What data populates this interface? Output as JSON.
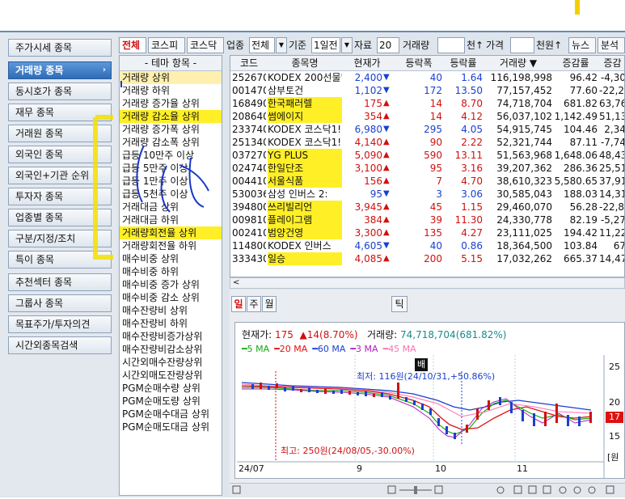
{
  "nav": {
    "items": [
      {
        "label": "주가시세 종목",
        "active": false
      },
      {
        "label": "거래량 종목",
        "active": true
      },
      {
        "label": "동시호가 종목",
        "active": false
      },
      {
        "label": "재무 종목",
        "active": false
      },
      {
        "label": "거래원 종목",
        "active": false
      },
      {
        "label": "외국인 종목",
        "active": false
      },
      {
        "label": "외국인+기관 순위",
        "active": false
      },
      {
        "label": "투자자 종목",
        "active": false
      },
      {
        "label": "업종별 종목",
        "active": false
      },
      {
        "label": "구분/지정/조치",
        "active": false
      },
      {
        "label": "특이 종목",
        "active": false
      },
      {
        "label": "추천섹터 종목",
        "active": false
      },
      {
        "label": "그룹사 종목",
        "active": false
      },
      {
        "label": "목표주가/투자의견",
        "active": false
      },
      {
        "label": "시간외종목검색",
        "active": false
      }
    ],
    "active_arrow": "›"
  },
  "toolbar": {
    "market_tabs": [
      "전체",
      "코스피",
      "코스닥"
    ],
    "selected_tab": "전체",
    "sector_label": "업종",
    "sector_value": "전체",
    "basis_label": "기준",
    "basis_value": "1일전",
    "data_label": "자료",
    "data_value": "20",
    "volume_label": "거래량",
    "volume_unit": "천↑",
    "price_label": "가격",
    "price_unit": "천원↑",
    "news_label": "뉴스",
    "analysis_label": "분석",
    "dropdown_arrow": "▼"
  },
  "theme": {
    "header": "- 테마 항목 -",
    "items": [
      "거래량 상위",
      "거래량 하위",
      "거래량 증가율 상위",
      "거래량 감소율 상위",
      "거래량 증가폭 상위",
      "거래량 감소폭 상위",
      "급등 10만주 이상",
      "급등 5만주 이상",
      "급등 1만주 이상",
      "급등 5천주 이상",
      "거래대금 상위",
      "거래대금 하위",
      "거래량회전율 상위",
      "거래량회전율 하위",
      "매수비중 상위",
      "매수비중 하위",
      "매수비중 증가 상위",
      "매수비중 감소 상위",
      "매수잔량비 상위",
      "매수잔량비 하위",
      "매수잔량비증가상위",
      "매수잔량비감소상위",
      "시간외매수잔량상위",
      "시간외매도잔량상위",
      "PGM순매수량 상위",
      "PGM순매도량 상위",
      "PGM순매수대금 상위",
      "PGM순매도대금 상위"
    ],
    "selected_index": 0,
    "highlighted": [
      3,
      12
    ]
  },
  "grid": {
    "columns": [
      "코드",
      "종목명",
      "현재가",
      "등락폭",
      "등락률",
      "거래량 ▼",
      "증감률",
      "증감"
    ],
    "rows": [
      {
        "code": "252670",
        "name": "KODEX 200선물'",
        "price": "2,400",
        "dir": "down",
        "change": "40",
        "rate": "1.64",
        "volume": "116,198,998",
        "vrate": "96.42",
        "vchg": "-4,30",
        "hl": false
      },
      {
        "code": "001470",
        "name": "삼부토건",
        "price": "1,102",
        "dir": "down",
        "change": "172",
        "rate": "13.50",
        "volume": "77,157,452",
        "vrate": "77.60",
        "vchg": "-22,27",
        "hl": false
      },
      {
        "code": "168490",
        "name": "한국패러렐",
        "price": "175",
        "dir": "up",
        "change": "14",
        "rate": "8.70",
        "volume": "74,718,704",
        "vrate": "681.82",
        "vchg": "63,76",
        "hl": true
      },
      {
        "code": "208640",
        "name": "썸에이지",
        "price": "354",
        "dir": "up",
        "change": "14",
        "rate": "4.12",
        "volume": "56,037,102",
        "vrate": "1,142.49",
        "vchg": "51,13",
        "hl": true
      },
      {
        "code": "233740",
        "name": "KODEX 코스닥1!",
        "price": "6,980",
        "dir": "down",
        "change": "295",
        "rate": "4.05",
        "volume": "54,915,745",
        "vrate": "104.46",
        "vchg": "2,34",
        "hl": false
      },
      {
        "code": "251340",
        "name": "KODEX 코스닥1!",
        "price": "4,140",
        "dir": "up",
        "change": "90",
        "rate": "2.22",
        "volume": "52,321,744",
        "vrate": "87.11",
        "vchg": "-7,74",
        "hl": false
      },
      {
        "code": "037270",
        "name": "YG PLUS",
        "price": "5,090",
        "dir": "up",
        "change": "590",
        "rate": "13.11",
        "volume": "51,563,968",
        "vrate": "1,648.06",
        "vchg": "48,43",
        "hl": true
      },
      {
        "code": "024740",
        "name": "한일단조",
        "price": "3,100",
        "dir": "up",
        "change": "95",
        "rate": "3.16",
        "volume": "39,207,362",
        "vrate": "286.36",
        "vchg": "25,51",
        "hl": true
      },
      {
        "code": "004410",
        "name": "서울식품",
        "price": "156",
        "dir": "up",
        "change": "7",
        "rate": "4.70",
        "volume": "38,610,323",
        "vrate": "5,580.65",
        "vchg": "37,91",
        "hl": true
      },
      {
        "code": "530036",
        "name": "삼성 인버스 2:",
        "price": "95",
        "dir": "down",
        "change": "3",
        "rate": "3.06",
        "volume": "30,585,043",
        "vrate": "188.03",
        "vchg": "14,31",
        "hl": false
      },
      {
        "code": "394800",
        "name": "쓰리빌리언",
        "price": "3,945",
        "dir": "up",
        "change": "45",
        "rate": "1.15",
        "volume": "29,460,070",
        "vrate": "56.28",
        "vchg": "-22,88",
        "hl": true
      },
      {
        "code": "009810",
        "name": "플레이그램",
        "price": "384",
        "dir": "up",
        "change": "39",
        "rate": "11.30",
        "volume": "24,330,778",
        "vrate": "82.19",
        "vchg": "-5,27",
        "hl": true
      },
      {
        "code": "002410",
        "name": "범양건영",
        "price": "3,300",
        "dir": "up",
        "change": "135",
        "rate": "4.27",
        "volume": "23,111,025",
        "vrate": "194.42",
        "vchg": "11,22",
        "hl": true
      },
      {
        "code": "114800",
        "name": "KODEX 인버스",
        "price": "4,605",
        "dir": "down",
        "change": "40",
        "rate": "0.86",
        "volume": "18,364,500",
        "vrate": "103.84",
        "vchg": "67",
        "hl": false
      },
      {
        "code": "333430",
        "name": "일승",
        "price": "4,085",
        "dir": "up",
        "change": "200",
        "rate": "5.15",
        "volume": "17,032,262",
        "vrate": "665.37",
        "vchg": "14,47",
        "hl": true
      }
    ],
    "scroll_left": "<"
  },
  "chart_panel": {
    "periods": [
      "일",
      "주",
      "월"
    ],
    "selected_period": "일",
    "tick_label": "틱",
    "info": {
      "price_label": "현재가:",
      "price": "175",
      "change": "▲14(8.70%)",
      "volume_label": "거래량:",
      "volume": "74,718,704(681.82%)"
    },
    "ma_legend": [
      {
        "label": "5 MA",
        "color": "#14a914"
      },
      {
        "label": "20 MA",
        "color": "#e01010"
      },
      {
        "label": "60 MA",
        "color": "#1a3fd0"
      },
      {
        "label": "3 MA",
        "color": "#b020c0"
      },
      {
        "label": "45 MA",
        "color": "#ff70b0"
      }
    ],
    "annotations": {
      "max_text": "최저: 116원(24/10/31,+50.86%)",
      "min_text": "최고: 250원(24/08/05,-30.00%)",
      "badge": "배"
    },
    "x_ticks": [
      "24/07",
      "9",
      "10",
      "11"
    ],
    "y_ticks": [
      "25",
      "20",
      "17",
      "15",
      "[원"
    ],
    "current_price_tag": "17"
  },
  "colors": {
    "up": "#d01010",
    "down": "#1a3fd0",
    "highlight": "#ffec00",
    "nav_active": "#3574c0"
  }
}
